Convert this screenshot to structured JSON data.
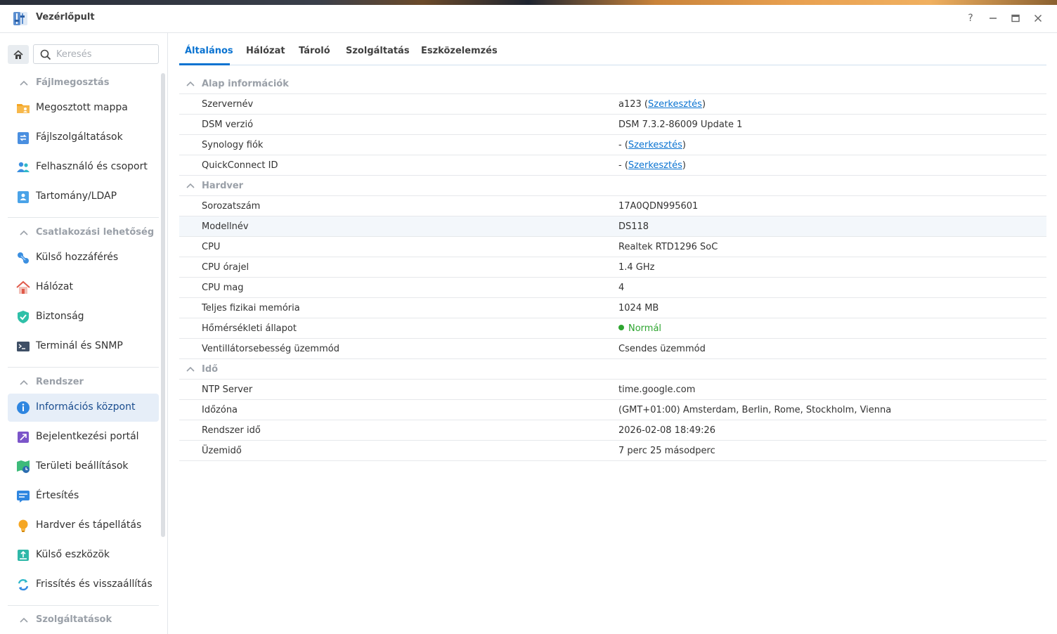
{
  "window": {
    "title": "Vezérlőpult"
  },
  "sidebar": {
    "search_placeholder": "Keresés",
    "sections": [
      {
        "label": "Fájlmegosztás",
        "items": [
          "Megosztott mappa",
          "Fájlszolgáltatások",
          "Felhasználó és csoport",
          "Tartomány/LDAP"
        ]
      },
      {
        "label": "Csatlakozási lehetőség",
        "items": [
          "Külső hozzáférés",
          "Hálózat",
          "Biztonság",
          "Terminál és SNMP"
        ]
      },
      {
        "label": "Rendszer",
        "items": [
          "Információs központ",
          "Bejelentkezési portál",
          "Területi beállítások",
          "Értesítés",
          "Hardver és tápellátás",
          "Külső eszközök",
          "Frissítés és visszaállítás"
        ]
      },
      {
        "label": "Szolgáltatások",
        "items": []
      }
    ],
    "active_item": "Információs központ"
  },
  "tabs": [
    "Általános",
    "Hálózat",
    "Tároló",
    "Szolgáltatás",
    "Eszközelemzés"
  ],
  "active_tab": "Általános",
  "groups": {
    "basic": {
      "label": "Alap információk",
      "server_name": {
        "key": "Szervernév",
        "value": "a123",
        "link": "Szerkesztés"
      },
      "dsm_version": {
        "key": "DSM verzió",
        "value": "DSM 7.3.2-86009 Update 1"
      },
      "synology_account": {
        "key": "Synology fiók",
        "value": "-",
        "link": "Szerkesztés"
      },
      "quickconnect": {
        "key": "QuickConnect ID",
        "value": "-",
        "link": "Szerkesztés"
      }
    },
    "hardware": {
      "label": "Hardver",
      "serial": {
        "key": "Sorozatszám",
        "value": "17A0QDN995601"
      },
      "model": {
        "key": "Modellnév",
        "value": "DS118"
      },
      "cpu": {
        "key": "CPU",
        "value": "Realtek RTD1296 SoC"
      },
      "cpu_clock": {
        "key": "CPU órajel",
        "value": "1.4 GHz"
      },
      "cpu_cores": {
        "key": "CPU mag",
        "value": "4"
      },
      "memory": {
        "key": "Teljes fizikai memória",
        "value": "1024 MB"
      },
      "thermal": {
        "key": "Hőmérsékleti állapot",
        "value": "Normál"
      },
      "fan": {
        "key": "Ventillátorsebesség üzemmód",
        "value": "Csendes üzemmód"
      }
    },
    "time": {
      "label": "Idő",
      "ntp": {
        "key": "NTP Server",
        "value": "time.google.com"
      },
      "timezone": {
        "key": "Időzóna",
        "value": "(GMT+01:00) Amsterdam, Berlin, Rome, Stockholm, Vienna"
      },
      "system_time": {
        "key": "Rendszer idő",
        "value": "2026-02-08 18:49:26"
      },
      "uptime": {
        "key": "Üzemidő",
        "value": "7 perc 25 másodperc"
      }
    }
  },
  "colors": {
    "accent": "#0a73d1",
    "status_ok": "#2ea530",
    "muted": "#9aa0a8"
  }
}
